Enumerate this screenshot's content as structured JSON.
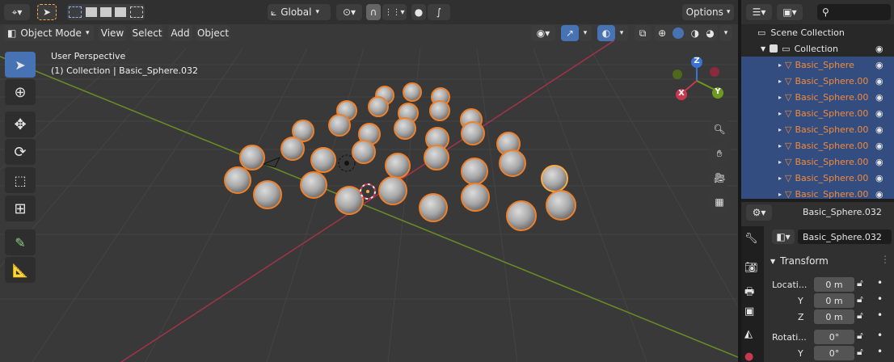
{
  "header": {
    "transform_orientation": "Global",
    "options_label": "Options"
  },
  "menubar": {
    "mode": "Object Mode",
    "items": [
      "View",
      "Select",
      "Add",
      "Object"
    ]
  },
  "viewport": {
    "perspective_label": "User Perspective",
    "context_label": "(1) Collection | Basic_Sphere.032",
    "gizmo": {
      "z": "Z",
      "y": "Y",
      "x": "X"
    }
  },
  "outliner": {
    "scene_collection": "Scene Collection",
    "collection": "Collection",
    "rows": [
      "Basic_Sphere",
      "Basic_Sphere.00",
      "Basic_Sphere.00",
      "Basic_Sphere.00",
      "Basic_Sphere.00",
      "Basic_Sphere.00",
      "Basic_Sphere.00",
      "Basic_Sphere.00",
      "Basic_Sphere.00"
    ]
  },
  "properties": {
    "object_name": "Basic_Sphere.032",
    "datablock_name": "Basic_Sphere.032",
    "panel_title": "Transform",
    "location_label": "Locati...",
    "rotation_label": "Rotati...",
    "y_label": "Y",
    "z_label": "Z",
    "loc_x": "0 m",
    "loc_y": "0 m",
    "loc_z": "0 m",
    "rot_x": "0°",
    "rot_y": "0°"
  },
  "colors": {
    "accent": "#4772b3",
    "selection_outline": "#f0802a",
    "active_outline": "#ffaa40",
    "x_axis": "#c8384e",
    "y_axis": "#6b9a1e"
  }
}
